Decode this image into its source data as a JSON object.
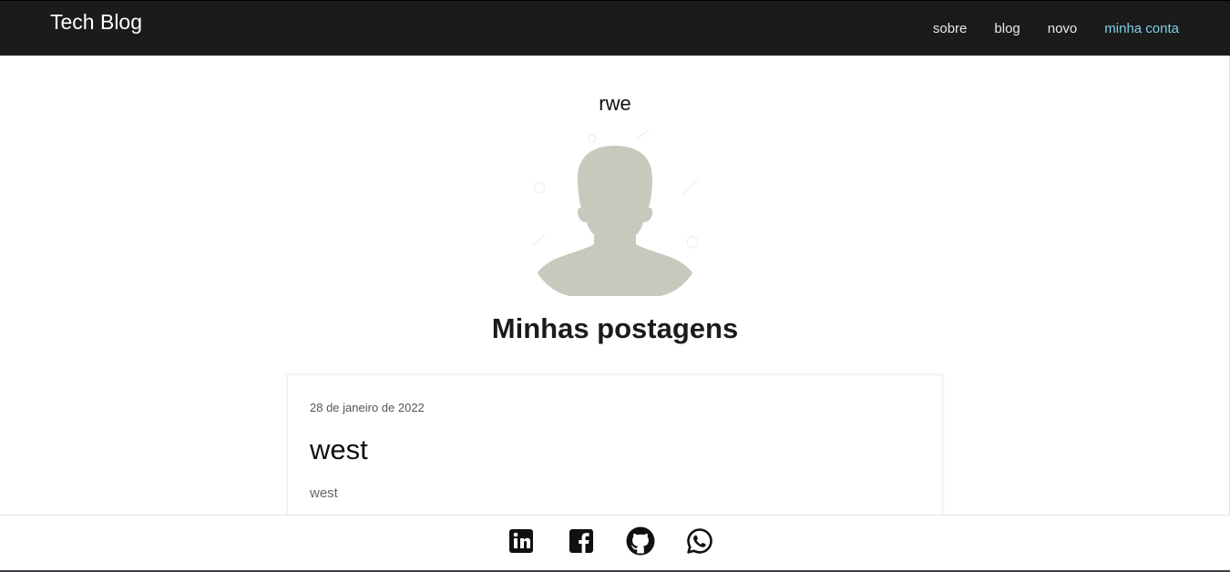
{
  "header": {
    "brand": "Tech Blog",
    "nav": [
      {
        "label": "sobre",
        "active": false
      },
      {
        "label": "blog",
        "active": false
      },
      {
        "label": "novo",
        "active": false
      },
      {
        "label": "minha conta",
        "active": true
      }
    ]
  },
  "profile": {
    "username": "rwe",
    "avatar_icon": "user-silhouette-icon"
  },
  "posts_section": {
    "title": "Minhas postagens",
    "posts": [
      {
        "date": "28 de janeiro de 2022",
        "title": "west",
        "excerpt": "west"
      }
    ]
  },
  "footer": {
    "social": [
      {
        "name": "linkedin-icon"
      },
      {
        "name": "facebook-icon"
      },
      {
        "name": "github-icon"
      },
      {
        "name": "whatsapp-icon"
      }
    ]
  },
  "colors": {
    "header_bg": "#1b1b1b",
    "active_link": "#7fd0e6",
    "avatar": "#c8c8bd"
  }
}
